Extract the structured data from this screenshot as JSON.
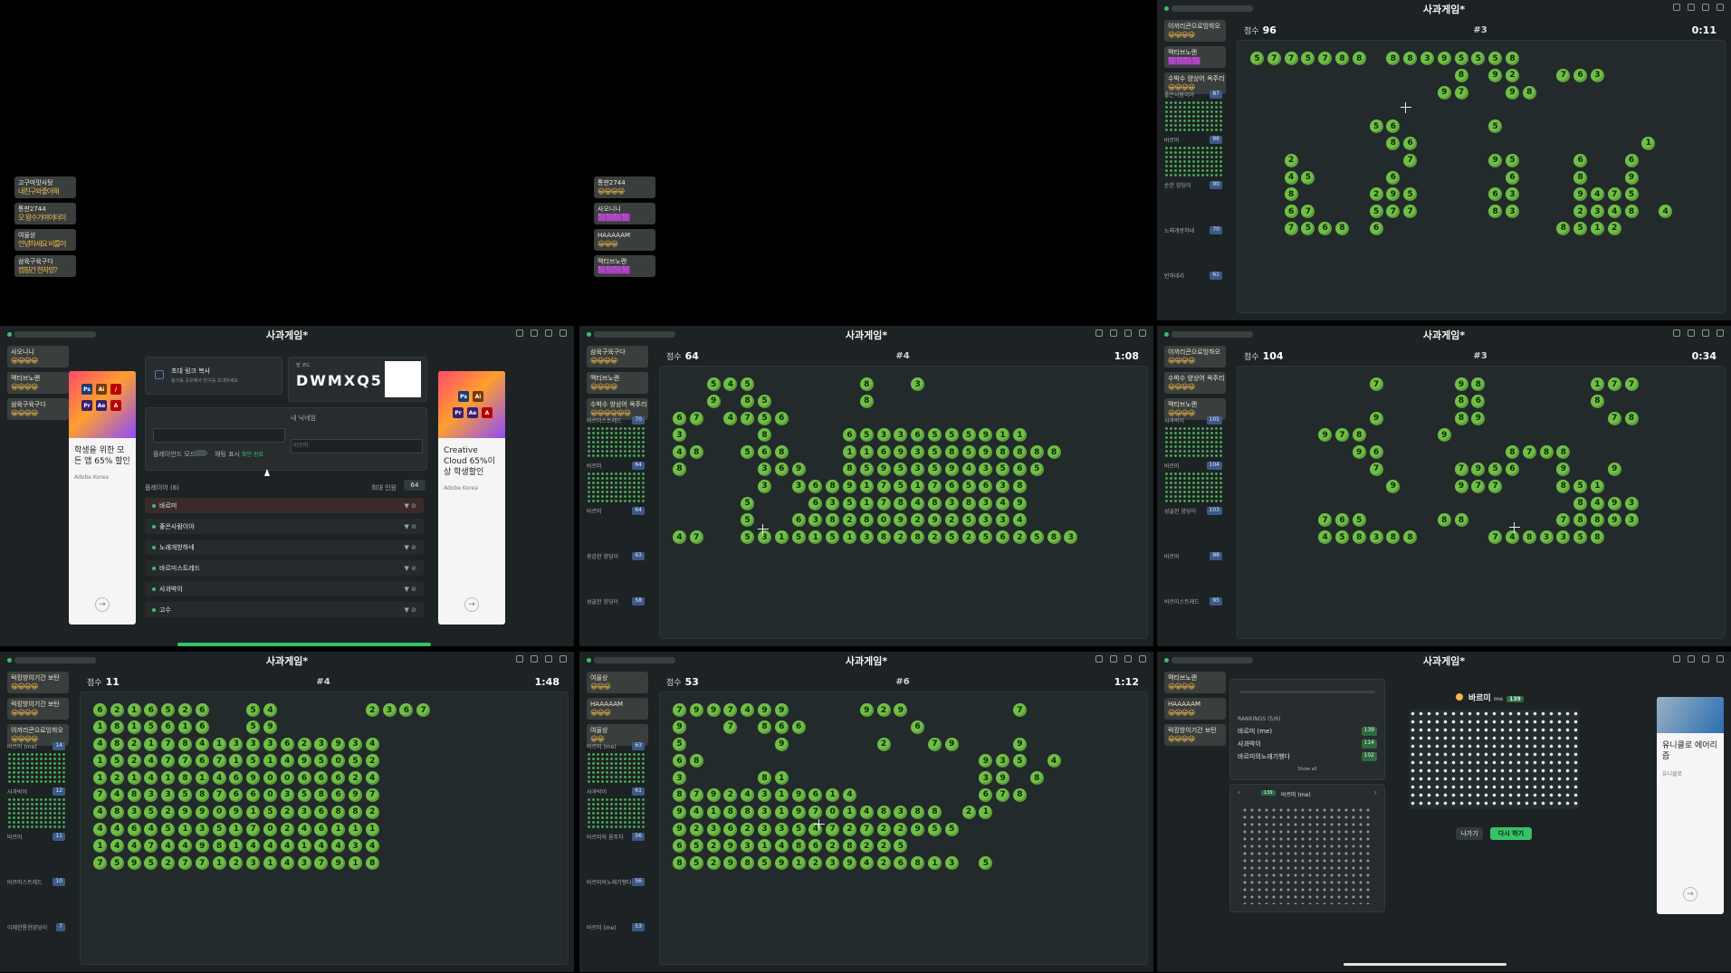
{
  "title": "사과게임*",
  "panels": [
    {
      "id": "p1",
      "kind": "chat-only",
      "chats": [
        {
          "name": "고구마맛사탕",
          "emo": "내친구와좋아해",
          "v": "emo"
        },
        {
          "name": "통판2744",
          "emo": "오 왕수가여이터이",
          "v": "emo"
        },
        {
          "name": "여울상",
          "emo": "안녕하세요 비틀어",
          "v": "emo"
        },
        {
          "name": "삼육구육구다",
          "emo": "캠핑간 한자망?",
          "v": "emo"
        }
      ]
    },
    {
      "id": "p2",
      "kind": "chat-only",
      "chats": [
        {
          "name": "통판2744",
          "emo": "😀😀😀😀",
          "v": "emo"
        },
        {
          "name": "사오니니",
          "emo": "🟪🟪🟪🟪",
          "v": "v"
        },
        {
          "name": "HAAAAAM",
          "emo": "😀😀😀",
          "v": "emo"
        },
        {
          "name": "맥티브노랜",
          "emo": "🟪🟪🟪🟪",
          "v": "v"
        }
      ]
    },
    {
      "id": "p3",
      "kind": "game",
      "score": "96",
      "round": "#3",
      "timer": "0:11",
      "cursor": [
        180,
        68
      ],
      "board": [
        "5775788 88395558",
        "            8 92  763",
        "           97  98",
        "",
        "       56     5",
        "        86             1",
        "  2      7    95   6  6",
        "  45    6      6   8  9",
        "  8    295    63   9475",
        "  67   577    83   2348 4",
        "  7568 6          8512"
      ],
      "sidebar": [
        {
          "label": "좋은사람이야",
          "score": "87"
        },
        {
          "label": "바르미",
          "score": "96"
        },
        {
          "label": "순한 양딩이",
          "score": "90"
        },
        {
          "label": "노래개방하네",
          "score": "70"
        },
        {
          "label": "빈하네리",
          "score": "61"
        }
      ],
      "chats": [
        {
          "name": "이끼리콘으로잉하오",
          "emo": "😀😀😀😀"
        },
        {
          "name": "맥티브노랜",
          "emo": "🟪🟪🟪🟪"
        },
        {
          "name": "수박수 양상어 옥주리",
          "emo": "😀😀😀😀"
        }
      ]
    },
    {
      "id": "p4",
      "kind": "lobby",
      "code": "DWMXQ5",
      "invite": "초대 링크 복사",
      "invite_sub": "링크를 공유해서 친구를 초대하세요",
      "room_label": "방 코드",
      "nickname_label": "내 닉네임",
      "nickname_ph": "바르미",
      "players_label": "플레이어 (6)",
      "max_label": "최대 인원",
      "max_value": "64",
      "fullscreen_label": "플레이언드 모드",
      "chat_label": "채팅 표시",
      "chat_value": "확인 완료",
      "players": [
        {
          "name": "바르미",
          "me": true
        },
        {
          "name": "좋은사람이야"
        },
        {
          "name": "노래개방하네"
        },
        {
          "name": "바르미스트레드"
        },
        {
          "name": "사과박이"
        },
        {
          "name": "고수"
        }
      ],
      "ad1": {
        "brand": "Adobe Korea",
        "text": "학생을 위한 모든 앱 65% 할인"
      },
      "ad2": {
        "brand": "Adobe Korea",
        "text": "Creative Cloud 65%이상 학생할인"
      },
      "chats": [
        {
          "name": "사오니니",
          "emo": "😀😀😀😀"
        },
        {
          "name": "맥티브노랜",
          "emo": "😀😀😀😀"
        },
        {
          "name": "삼육구육구다",
          "emo": "😀😀😀😀"
        }
      ]
    },
    {
      "id": "p5",
      "kind": "game",
      "score": "64",
      "round": "#4",
      "timer": "1:08",
      "cursor": [
        108,
        174
      ],
      "board": [
        "  545      8  3",
        "  9 85     8",
        "67 4756",
        "3    8    65336555911",
        "48  568   1169358598888",
        "8    369  859535943565",
        "     3 36891751765638",
        "    5   6351784838349",
        "    5  63828092925334",
        "47  53151513828252562583"
      ],
      "sidebar": [
        {
          "label": "바르미스트레드",
          "score": "70"
        },
        {
          "label": "바르미",
          "score": "64"
        },
        {
          "label": "바르미",
          "score": "64"
        },
        {
          "label": "용감한 양딩이",
          "score": "63"
        },
        {
          "label": "성골한 양딩이",
          "score": "58"
        }
      ],
      "chats": [
        {
          "name": "삼육구육구다",
          "emo": "😀😀😀😀"
        },
        {
          "name": "맥티브노랜",
          "emo": "😀😀😀😀"
        },
        {
          "name": "수박수 양상어 옥주리",
          "emo": "😀😀😀😀😀😀"
        }
      ]
    },
    {
      "id": "p6",
      "kind": "game",
      "score": "104",
      "round": "#3",
      "timer": "0:34",
      "cursor": [
        300,
        172
      ],
      "board": [
        "       7    98      177",
        "            86      8",
        "       9    89       78",
        "    978    9",
        "      96       8788",
        "       7    7956  9  9",
        "        9   977   851",
        "                   8493",
        "    765    88     78893",
        "    458388    7483358"
      ],
      "sidebar": [
        {
          "label": "사과박이",
          "score": "105"
        },
        {
          "label": "바르미",
          "score": "104"
        },
        {
          "label": "성골한 양딩이",
          "score": "103"
        },
        {
          "label": "바르미",
          "score": "98"
        },
        {
          "label": "바르미스트레드",
          "score": "95"
        }
      ],
      "chats": [
        {
          "name": "이끼리콘으로잉하오",
          "emo": "😀😀😀😀"
        },
        {
          "name": "수박수 양상어 옥주리",
          "emo": "😀😀😀😀"
        },
        {
          "name": "맥티브노랜",
          "emo": "😀😀😀😀"
        }
      ]
    },
    {
      "id": "p7",
      "kind": "game",
      "score": "11",
      "round": "#4",
      "timer": "1:48",
      "cursor": [
        0,
        0
      ],
      "board": [
        "6216526  54     2367",
        "1815616  59",
        "48217841333623934",
        "15247767151495052",
        "12141814690066624",
        "74833587660358697",
        "48352990915236882",
        "44645135170246111",
        "14474498144414434",
        "75952771231437918"
      ],
      "sidebar": [
        {
          "label": "바르미 (me)",
          "score": "14"
        },
        {
          "label": "사과박이",
          "score": "12"
        },
        {
          "label": "바르미",
          "score": "11"
        },
        {
          "label": "바르미스트레드",
          "score": "10"
        },
        {
          "label": "이제한통한양딩이",
          "score": "7"
        }
      ],
      "chats": [
        {
          "name": "럭킹방이기간 보탄",
          "emo": "😀😀😀😀"
        },
        {
          "name": "럭킹방이기간 보탄",
          "emo": "😀😀😀😀"
        },
        {
          "name": "이끼리콘으로잉하오",
          "emo": "😀😀😀😀"
        }
      ]
    },
    {
      "id": "p8",
      "kind": "game",
      "score": "53",
      "round": "#6",
      "timer": "1:12",
      "cursor": [
        170,
        140
      ],
      "board": [
        "7997499    929      7",
        "9  7 866      6",
        "5     9     2  79   9",
        "68                935 4",
        "3    81           39 8",
        "87924319614       678",
        "9418831970148388 21",
        "92362335472722955",
        "65293148628225",
        "85298591239426813 5"
      ],
      "sidebar": [
        {
          "label": "바르미 (me)",
          "score": "63"
        },
        {
          "label": "사과박이",
          "score": "61"
        },
        {
          "label": "바르미의 움주차",
          "score": "56"
        },
        {
          "label": "바르미의노래기행다",
          "score": "56"
        },
        {
          "label": "바르미 (me)",
          "score": "53"
        }
      ],
      "chats": [
        {
          "name": "여울상",
          "emo": "😀😀😀"
        },
        {
          "name": "HAAAAAM",
          "emo": "😀😀😀"
        },
        {
          "name": "여울상",
          "emo": "😀😀"
        }
      ]
    },
    {
      "id": "p9",
      "kind": "result",
      "winner": "바르미",
      "winner_tag": "me",
      "winner_score": "139",
      "rank_title": "RANKINGS (5/6)",
      "rankings": [
        {
          "name": "바르미 (me)",
          "pts": "139"
        },
        {
          "name": "사과박이",
          "pts": "114"
        },
        {
          "name": "바르미의노래기행다",
          "pts": "102"
        }
      ],
      "rank_more": "Show all",
      "carousel": "바르미 (me)",
      "carousel_pts": "139",
      "btn_leave": "나가기",
      "btn_again": "다시 하기",
      "ad": {
        "brand": "유니클로",
        "text": "유니클로 에어리즘"
      },
      "chats": [
        {
          "name": "맥티브노랜",
          "emo": "😀😀😀😀"
        },
        {
          "name": "HAAAAAM",
          "emo": "😀😀😀😀"
        },
        {
          "name": "럭킹방이기간 보탄",
          "emo": "😀😀😀😀"
        }
      ]
    }
  ],
  "colors": {
    "bg": "#1d2224",
    "apple": "#6fbf45",
    "accent": "#38c26a"
  },
  "icons": {
    "close": "close-icon",
    "settings": "gear-icon",
    "sound": "speaker-icon",
    "theme": "moon-icon"
  }
}
